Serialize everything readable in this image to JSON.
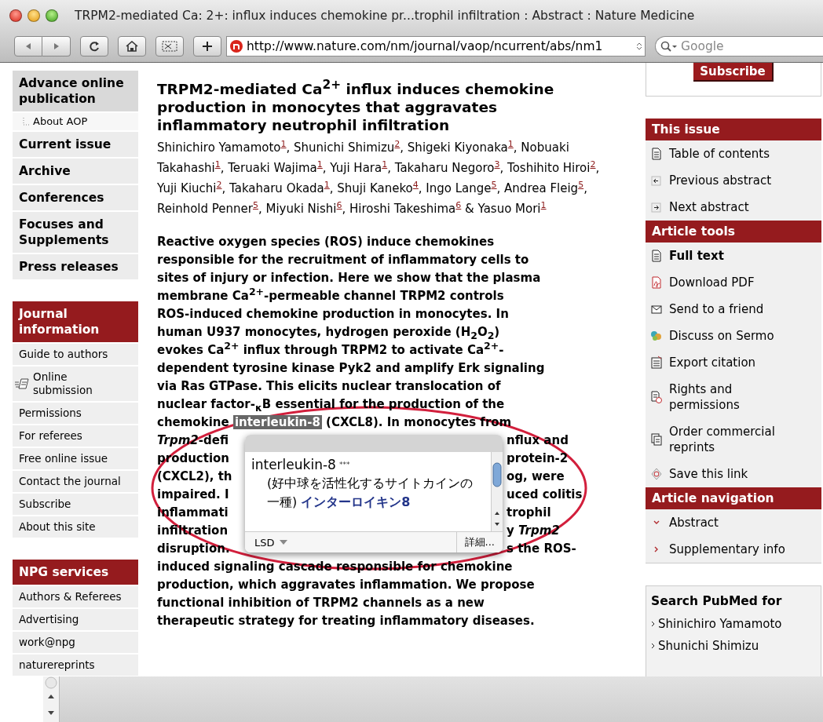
{
  "window": {
    "title": "TRPM2-mediated Ca: 2+: influx induces chemokine pr...trophil infiltration : Abstract : Nature Medicine"
  },
  "toolbar": {
    "url": "http://www.nature.com/nm/journal/vaop/ncurrent/abs/nm1",
    "search": {
      "placeholder": "Google"
    }
  },
  "left_nav": {
    "groups": [
      {
        "items": [
          {
            "label": "Advance online publication",
            "kind": "main",
            "selected": true
          },
          {
            "label": "About AOP",
            "kind": "sub",
            "selected": false
          },
          {
            "label": "Current issue",
            "kind": "main",
            "selected": false
          },
          {
            "label": "Archive",
            "kind": "main",
            "selected": false
          },
          {
            "label": "Conferences",
            "kind": "main",
            "selected": false
          },
          {
            "label": "Focuses and Supplements",
            "kind": "main",
            "selected": false
          },
          {
            "label": "Press releases",
            "kind": "main",
            "selected": false
          }
        ]
      },
      {
        "heading": "Journal information",
        "items": [
          {
            "label": "Guide to authors",
            "kind": "plain"
          },
          {
            "label": "Online submission",
            "kind": "form"
          },
          {
            "label": "Permissions",
            "kind": "plain"
          },
          {
            "label": "For referees",
            "kind": "plain"
          },
          {
            "label": "Free online issue",
            "kind": "plain"
          },
          {
            "label": "Contact the journal",
            "kind": "plain"
          },
          {
            "label": "Subscribe",
            "kind": "plain"
          },
          {
            "label": "About this site",
            "kind": "plain"
          }
        ]
      },
      {
        "heading": "NPG services",
        "items": [
          {
            "label": "Authors & Referees",
            "kind": "plain"
          },
          {
            "label": "Advertising",
            "kind": "plain"
          },
          {
            "label": "work@npg",
            "kind": "plain"
          },
          {
            "label": "naturereprints",
            "kind": "plain"
          }
        ]
      }
    ]
  },
  "article": {
    "title": "TRPM2-mediated Ca$^{2+}$ influx induces chemokine production in monocytes that aggravates inflammatory neutrophil infiltration",
    "authors": "Shinichiro Yamamoto$^{1}$, Shunichi Shimizu$^{2}$, Shigeki Kiyonaka$^{1}$, Nobuaki Takahashi$^{1}$, Teruaki Wajima$^{1}$, Yuji Hara$^{1}$, Takaharu Negoro$^{3}$, Toshihito Hiroi$^{2}$, Yuji Kiuchi$^{2}$, Takaharu Okada$^{1}$, Shuji Kaneko$^{4}$, Ingo Lange$^{5}$, Andrea Fleig$^{5}$, Reinhold Penner$^{5}$, Miyuki Nishi$^{6}$, Hiroshi Takeshima$^{6}$ & Yasuo Mori$^{1}$",
    "abstract_lines": [
      {
        "kind": "full",
        "text": "Reactive oxygen species (ROS) induce chemokines"
      },
      {
        "kind": "full",
        "text": "responsible for the recruitment of inflammatory cells to"
      },
      {
        "kind": "full",
        "text": "sites of injury or infection. Here we show that the plasma"
      },
      {
        "kind": "full",
        "text": "membrane Ca$^{2+}$-permeable channel TRPM2 controls"
      },
      {
        "kind": "full",
        "text": "ROS-induced chemokine production in monocytes. In"
      },
      {
        "kind": "full",
        "text": "human U937 monocytes, hydrogen peroxide (H$_{2}$O$_{2}$)"
      },
      {
        "kind": "full",
        "text": "evokes Ca$^{2+}$ influx through TRPM2 to activate Ca$^{2+}$-"
      },
      {
        "kind": "full",
        "text": "dependent tyrosine kinase Pyk2 and amplify Erk signaling"
      },
      {
        "kind": "full",
        "text": "via Ras GTPase. This elicits nuclear translocation of"
      },
      {
        "kind": "full",
        "text": "nuclear factor-$_{κ}$B essential for the production of the"
      },
      {
        "kind": "highlight",
        "before": "chemokine ",
        "highlight": "interleukin-8",
        "after": " (CXCL8). In monocytes from"
      },
      {
        "kind": "split",
        "left": "*Trpm2*-defi",
        "right": "nflux and"
      },
      {
        "kind": "split",
        "left": "production",
        "right": "protein-2"
      },
      {
        "kind": "split",
        "left": "(CXCL2), th",
        "right": "og, were"
      },
      {
        "kind": "split",
        "left": "impaired. I",
        "right": "uced colitis"
      },
      {
        "kind": "split",
        "left": "inflammati",
        "right": "trophil"
      },
      {
        "kind": "split",
        "left": "infiltration",
        "right": "y *Trpm2*"
      },
      {
        "kind": "split",
        "left": "disruption.",
        "right": "s the ROS-"
      },
      {
        "kind": "full",
        "text": "induced signaling cascade responsible for chemokine"
      },
      {
        "kind": "full",
        "text": "production, which aggravates inflammation. We propose"
      },
      {
        "kind": "full",
        "text": "functional inhibition of TRPM2 channels as a new"
      },
      {
        "kind": "full",
        "text": "therapeutic strategy for treating inflammatory diseases."
      }
    ],
    "popup": {
      "term": "interleukin-8",
      "rating": "***",
      "definition": "(好中球を活性化するサイトカインの一種)",
      "translation": "インターロイキン8",
      "dictionary": "LSD",
      "more_button": "詳細..."
    }
  },
  "right_sidebar": {
    "subscribe_button": "Subscribe",
    "sections": [
      {
        "heading": "This issue",
        "items": [
          {
            "label": "Table of contents",
            "kind": "doc",
            "current": false
          },
          {
            "label": "Previous abstract",
            "kind": "prev",
            "current": false
          },
          {
            "label": "Next abstract",
            "kind": "next",
            "current": false
          }
        ]
      },
      {
        "heading": "Article tools",
        "items": [
          {
            "label": "Full text",
            "kind": "doc",
            "current": true
          },
          {
            "label": "Download PDF",
            "kind": "pdf",
            "current": false
          },
          {
            "label": "Send to a friend",
            "kind": "mail",
            "current": false
          },
          {
            "label": "Discuss on Sermo",
            "kind": "discuss",
            "current": false
          },
          {
            "label": "Export citation",
            "kind": "export",
            "current": false
          },
          {
            "label": "Rights and permissions",
            "kind": "rights",
            "current": false
          },
          {
            "label": "Order commercial reprints",
            "kind": "reprints",
            "current": false
          },
          {
            "label": "Save this link",
            "kind": "save",
            "current": false
          }
        ]
      },
      {
        "heading": "Article navigation",
        "items": [
          {
            "label": "Abstract",
            "kind": "down",
            "current": false
          },
          {
            "label": "Supplementary info",
            "kind": "right",
            "current": false
          }
        ]
      }
    ],
    "pubmed": {
      "title": "Search PubMed for",
      "items": [
        "Shinichiro Yamamoto",
        "Shunichi Shimizu"
      ]
    }
  }
}
